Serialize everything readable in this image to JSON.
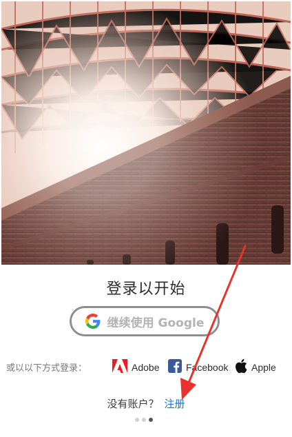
{
  "login": {
    "title": "登录以开始",
    "google_button_label": "继续使用 Google",
    "alt_signin_label": "或以以下方式登录：",
    "providers": [
      {
        "name": "Adobe",
        "icon": "adobe-icon",
        "color": "#ed1c24"
      },
      {
        "name": "Facebook",
        "icon": "facebook-icon",
        "color": "#3b5998"
      },
      {
        "name": "Apple",
        "icon": "apple-icon",
        "color": "#111111"
      }
    ],
    "no_account_text": "没有账户？",
    "signup_link": "注册",
    "link_color": "#1473e6"
  },
  "carousel": {
    "page_count": 3,
    "active_page": 3
  },
  "annotation": {
    "type": "red-arrow",
    "color": "#e8322c",
    "points_to": "signup-link"
  }
}
